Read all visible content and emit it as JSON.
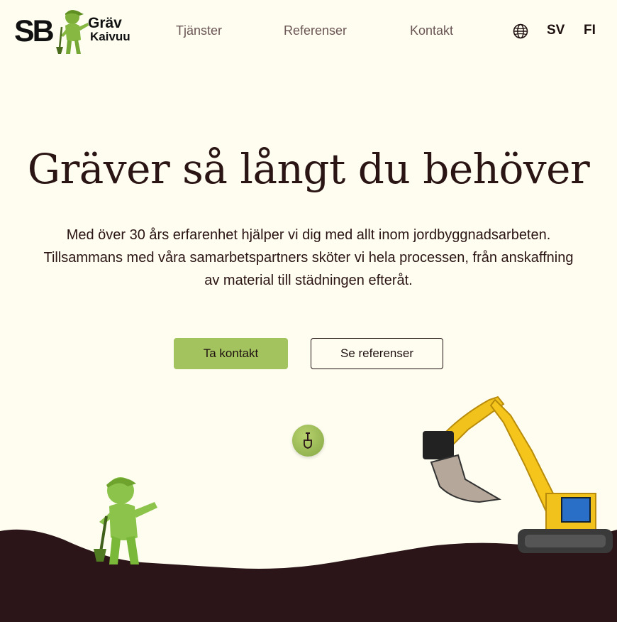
{
  "logo": {
    "mark": "SB",
    "line1": "Gräv",
    "line2": "Kaivuu"
  },
  "nav": {
    "items": [
      {
        "label": "Tjänster"
      },
      {
        "label": "Referenser"
      },
      {
        "label": "Kontakt"
      }
    ]
  },
  "language": {
    "icon": "globe-icon",
    "options": [
      "SV",
      "FI"
    ]
  },
  "hero": {
    "headline": "Gräver så långt du behöver",
    "lead": "Med över 30 års erfarenhet hjälper vi dig med allt inom jordbyggnadsarbeten. Tillsammans med våra samarbetspartners sköter vi hela processen, från anskaffning av material till städningen efteråt.",
    "primary_button": "Ta kontakt",
    "secondary_button": "Se referenser",
    "scroll_icon": "shovel-icon"
  },
  "colors": {
    "background": "#fefdf0",
    "accent_green": "#a3c35f",
    "text_dark": "#2a1414",
    "soil": "#2b1518",
    "nav_text": "#6a5555"
  }
}
